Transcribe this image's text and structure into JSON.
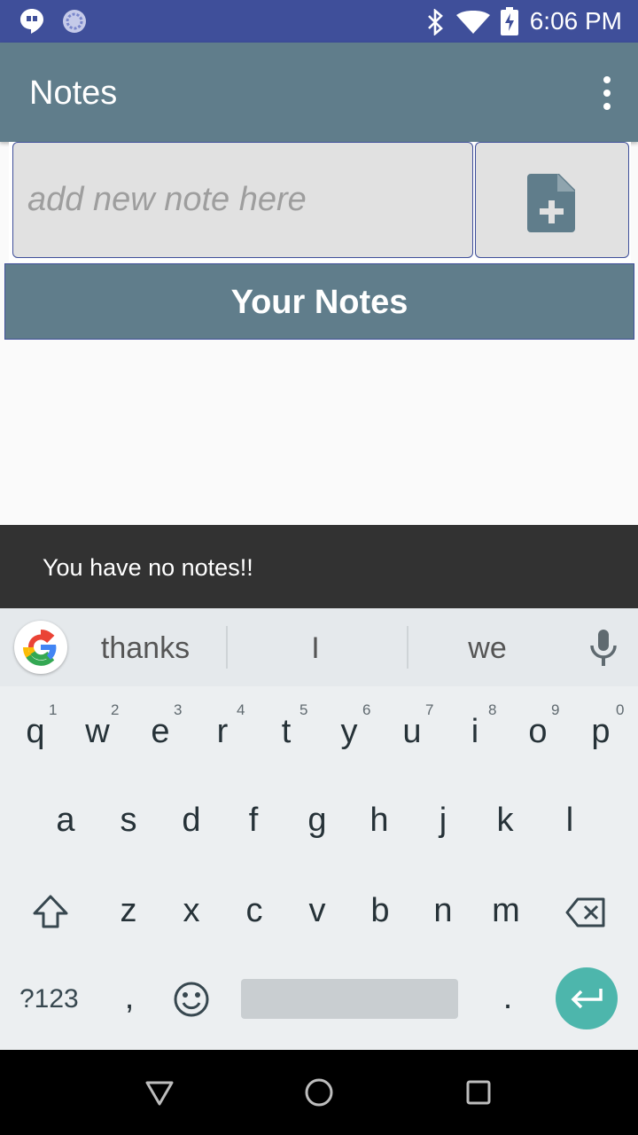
{
  "status_bar": {
    "time": "6:06 PM",
    "icons": [
      "hangouts-icon",
      "sync-icon",
      "bluetooth-icon",
      "wifi-icon",
      "battery-charging-icon"
    ]
  },
  "app_bar": {
    "title": "Notes",
    "overflow_icon": "more-vert-icon"
  },
  "note_input": {
    "placeholder": "add new note here",
    "value": ""
  },
  "add_button": {
    "icon": "note-add-icon"
  },
  "notes_header": {
    "label": "Your Notes"
  },
  "snackbar": {
    "message": "You have no notes!!"
  },
  "keyboard": {
    "suggestions": [
      "thanks",
      "I",
      "we"
    ],
    "row1": [
      "q",
      "w",
      "e",
      "r",
      "t",
      "y",
      "u",
      "i",
      "o",
      "p"
    ],
    "row1_hints": [
      "1",
      "2",
      "3",
      "4",
      "5",
      "6",
      "7",
      "8",
      "9",
      "0"
    ],
    "row2": [
      "a",
      "s",
      "d",
      "f",
      "g",
      "h",
      "j",
      "k",
      "l"
    ],
    "row3": [
      "z",
      "x",
      "c",
      "v",
      "b",
      "n",
      "m"
    ],
    "symbols_label": "?123",
    "comma": ",",
    "period": "."
  },
  "colors": {
    "primary": "#607d8b",
    "status_bar": "#3f4f9a",
    "accent": "#4db6ac",
    "snackbar": "#323232"
  }
}
